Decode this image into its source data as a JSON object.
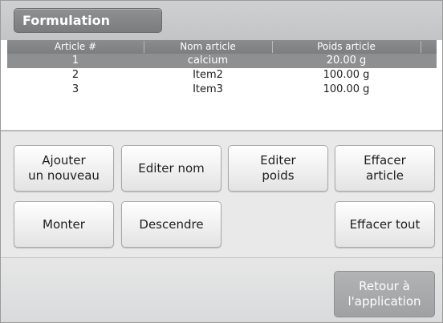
{
  "header": {
    "title": "Formulation"
  },
  "table": {
    "columns": [
      "Article #",
      "Nom article",
      "Poids article"
    ],
    "rows": [
      {
        "num": "1",
        "name": "calcium",
        "weight": "20.00 g",
        "selected": true
      },
      {
        "num": "2",
        "name": "Item2",
        "weight": "100.00 g",
        "selected": false
      },
      {
        "num": "3",
        "name": "Item3",
        "weight": "100.00 g",
        "selected": false
      }
    ]
  },
  "buttons": {
    "add_new": "Ajouter\nun nouveau",
    "edit_name": "Editer nom",
    "edit_weight": "Editer\npoids",
    "delete_item": "Effacer\narticle",
    "move_up": "Monter",
    "move_down": "Descendre",
    "delete_all": "Effacer tout"
  },
  "footer": {
    "return_label": "Retour à\nl'application"
  },
  "colors": {
    "header_bg": "#c8c9cb",
    "title_tab": "#858688",
    "table_head": "#858688",
    "selected_row": "#8e8f91",
    "panel_bg": "#e9e9ea",
    "return_button": "#a9aaac"
  }
}
